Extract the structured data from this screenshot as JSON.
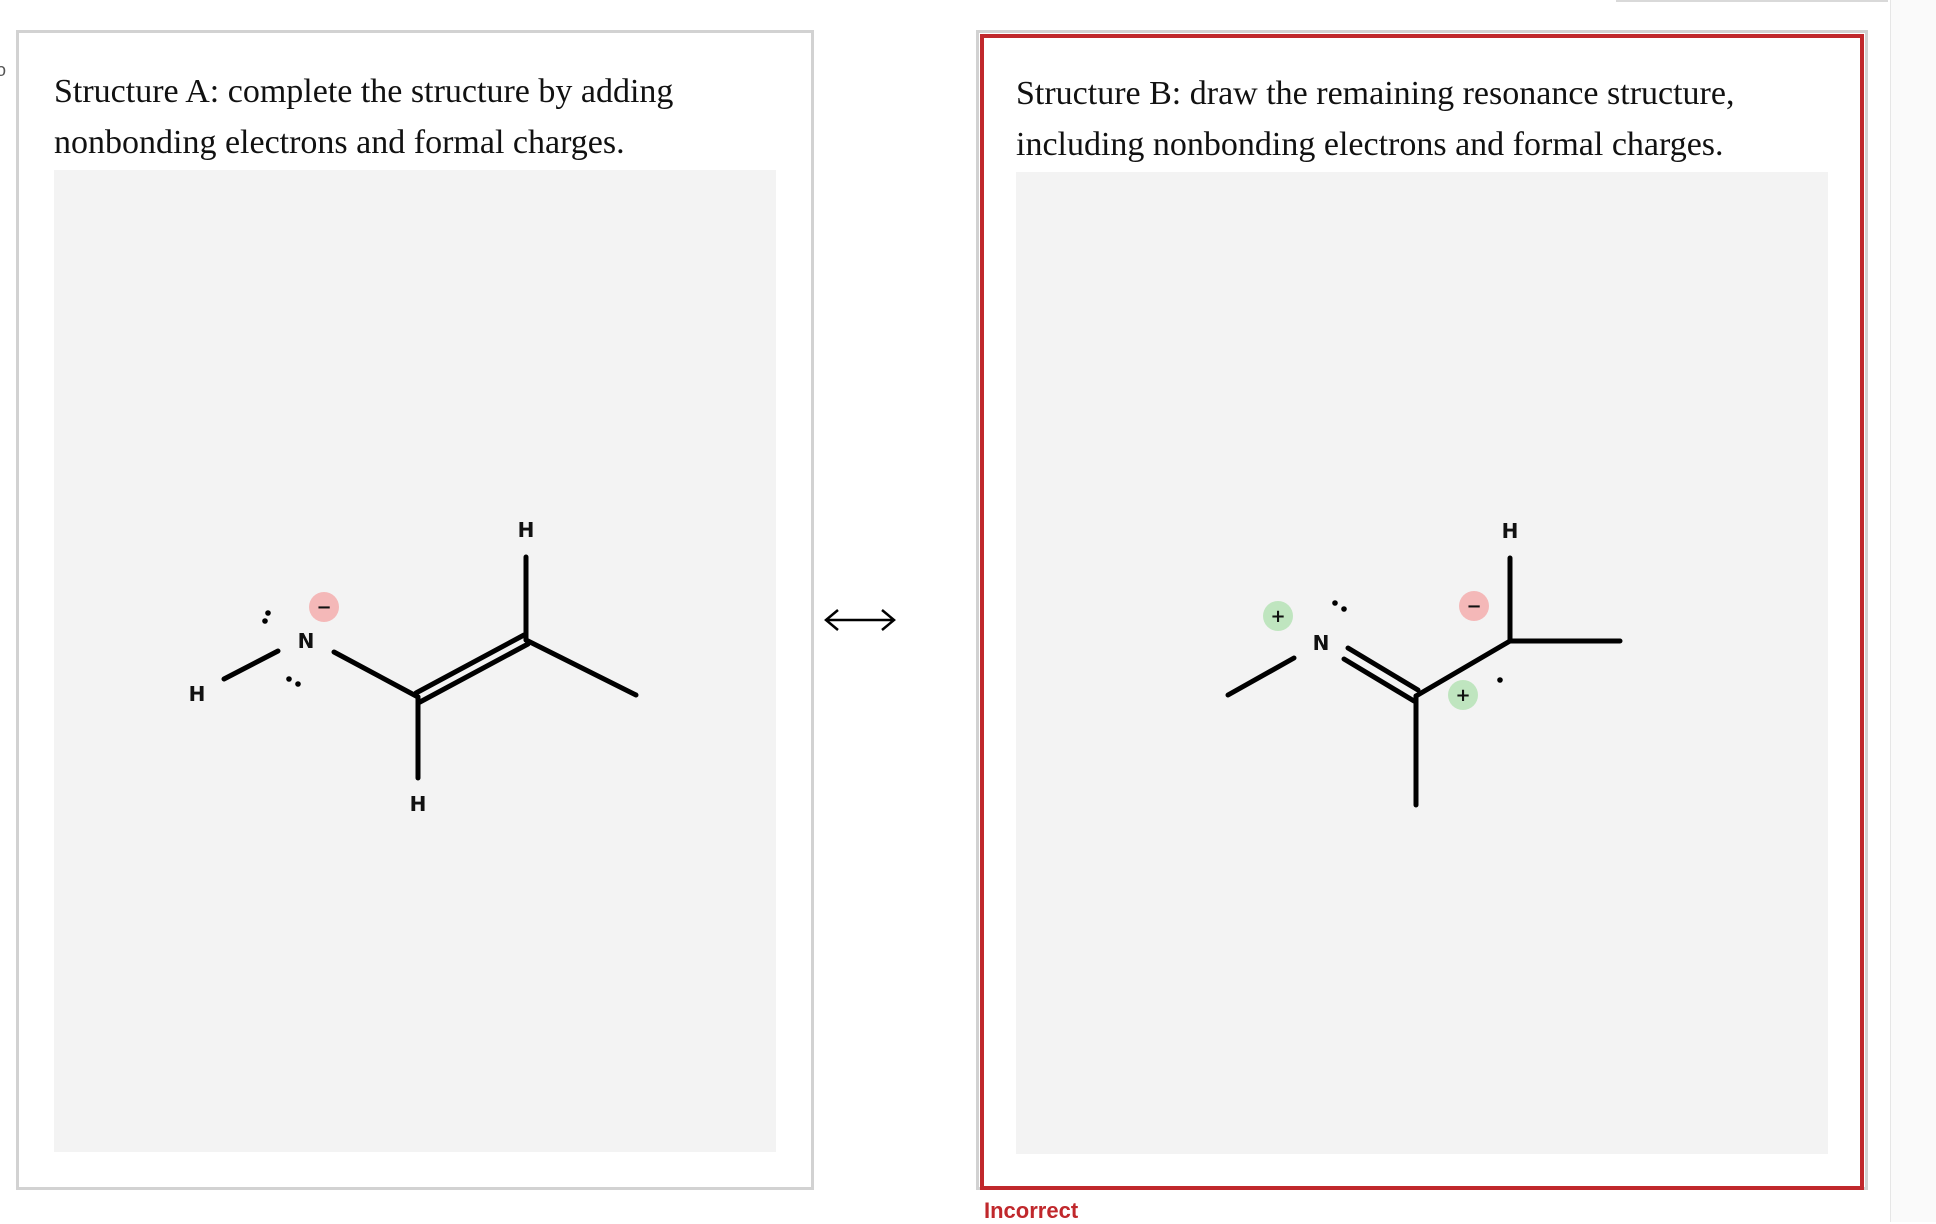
{
  "edge_glyph": "o",
  "structure_a": {
    "prompt": "Structure A: complete the structure by adding nonbonding electrons and formal charges.",
    "atoms": {
      "h_left": "H",
      "n": "N",
      "h_top": "H",
      "h_bottom": "H"
    },
    "charges": {
      "n_charge": "−"
    }
  },
  "resonance_arrow": "⟷",
  "structure_b": {
    "prompt": "Structure B: draw the remaining resonance structure, including nonbonding electrons and formal charges.",
    "atoms": {
      "n": "N",
      "h_top": "H"
    },
    "charges": {
      "n_charge": "+",
      "c_neg": "−",
      "c_pos": "+"
    }
  },
  "feedback": "Incorrect",
  "colors": {
    "error": "#c0282c",
    "neg_charge": "#f4b8b8",
    "pos_charge": "#bfe5bf",
    "canvas": "#f3f3f3"
  }
}
